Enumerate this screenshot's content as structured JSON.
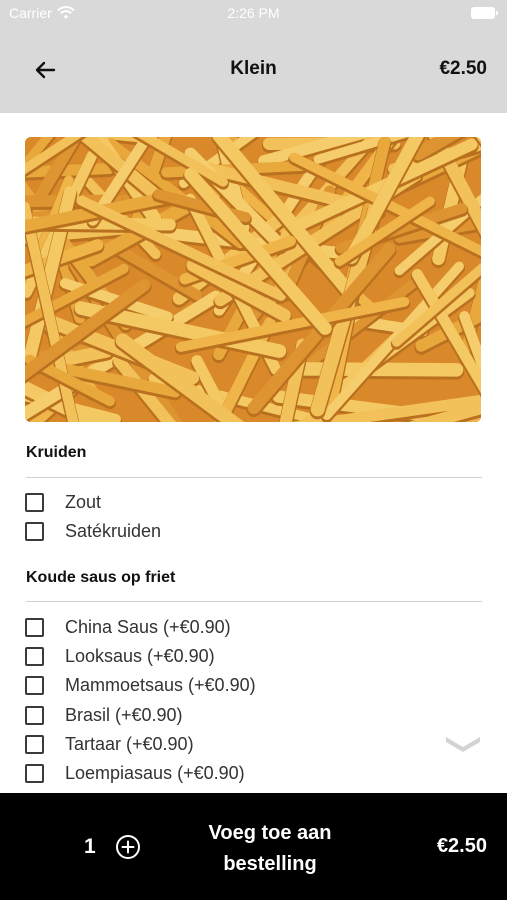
{
  "status_bar": {
    "carrier": "Carrier",
    "time": "2:26 PM"
  },
  "header": {
    "back_icon": "arrow-left-icon",
    "title": "Klein",
    "price": "€2.50"
  },
  "product_image": {
    "subject": "french fries"
  },
  "groups": [
    {
      "title": "Kruiden",
      "options": [
        {
          "label": "Zout",
          "checked": false
        },
        {
          "label": "Satékruiden",
          "checked": false
        }
      ]
    },
    {
      "title": "Koude saus op friet",
      "options": [
        {
          "label": "China Saus (+€0.90)",
          "checked": false
        },
        {
          "label": "Looksaus (+€0.90)",
          "checked": false
        },
        {
          "label": "Mammoetsaus (+€0.90)",
          "checked": false
        },
        {
          "label": "Brasil (+€0.90)",
          "checked": false
        },
        {
          "label": "Tartaar (+€0.90)",
          "checked": false
        },
        {
          "label": "Loempiasaus (+€0.90)",
          "checked": false
        }
      ]
    }
  ],
  "bottom_bar": {
    "quantity": "1",
    "add_icon": "plus-circle-icon",
    "order_label_line1": "Voeg toe aan",
    "order_label_line2": "bestelling",
    "total": "€2.50"
  },
  "colors": {
    "header_bg": "#d9d9d9",
    "bottom_bg": "#000000",
    "fries": "#e8a53a"
  }
}
